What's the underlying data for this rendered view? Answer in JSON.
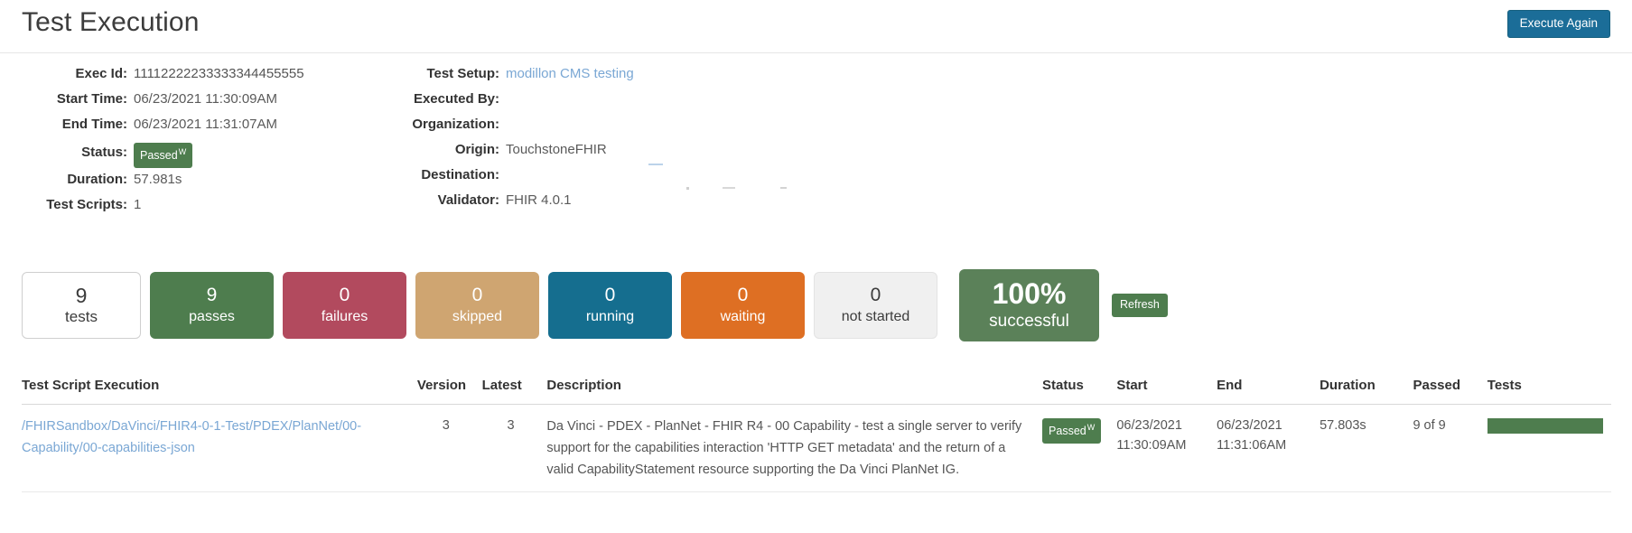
{
  "header": {
    "title": "Test Execution",
    "execute_again_label": "Execute Again"
  },
  "info": {
    "left": [
      {
        "label": "Exec Id:",
        "value": "11112222233333344455555",
        "type": "text"
      },
      {
        "label": "Start Time:",
        "value": "06/23/2021 11:30:09AM",
        "type": "text"
      },
      {
        "label": "End Time:",
        "value": "06/23/2021 11:31:07AM",
        "type": "text"
      },
      {
        "label": "Status:",
        "value": "Passed",
        "type": "badge",
        "badge_sup": "W"
      },
      {
        "label": "Duration:",
        "value": "57.981s",
        "type": "text"
      },
      {
        "label": "Test Scripts:",
        "value": "1",
        "type": "text"
      }
    ],
    "right": [
      {
        "label": "Test Setup:",
        "value": "modillon CMS testing",
        "type": "link"
      },
      {
        "label": "Executed By:",
        "value": "",
        "type": "text"
      },
      {
        "label": "Organization:",
        "value": "",
        "type": "text"
      },
      {
        "label": "Origin:",
        "value": "TouchstoneFHIR",
        "type": "text"
      },
      {
        "label": "Destination:",
        "value": "",
        "type": "text"
      },
      {
        "label": "Validator:",
        "value": "FHIR 4.0.1",
        "type": "text"
      }
    ]
  },
  "tiles": [
    {
      "key": "tests",
      "number": "9",
      "label": "tests",
      "color": "#ffffff"
    },
    {
      "key": "passes",
      "number": "9",
      "label": "passes",
      "color": "#4e7d4e"
    },
    {
      "key": "failures",
      "number": "0",
      "label": "failures",
      "color": "#b24a5e"
    },
    {
      "key": "skipped",
      "number": "0",
      "label": "skipped",
      "color": "#cfa571"
    },
    {
      "key": "running",
      "number": "0",
      "label": "running",
      "color": "#156e8f"
    },
    {
      "key": "waiting",
      "number": "0",
      "label": "waiting",
      "color": "#de6f23"
    },
    {
      "key": "notstarted",
      "number": "0",
      "label": "not started",
      "color": "#f0f0f0"
    },
    {
      "key": "success",
      "number": "100%",
      "label": "successful",
      "color": "#5b8159"
    }
  ],
  "refresh_label": "Refresh",
  "table": {
    "headers": [
      "Test Script Execution",
      "Version",
      "Latest",
      "Description",
      "Status",
      "Start",
      "End",
      "Duration",
      "Passed",
      "Tests"
    ],
    "rows": [
      {
        "name": "/FHIRSandbox/DaVinci/FHIR4-0-1-Test/PDEX/PlanNet/00-Capability/00-capabilities-json",
        "version": "3",
        "latest": "3",
        "description": "Da Vinci - PDEX - PlanNet - FHIR R4 - 00 Capability - test a single server to verify support for the capabilities interaction 'HTTP GET metadata' and the return of a valid CapabilityStatement resource supporting the Da Vinci PlanNet IG.",
        "status": "Passed",
        "status_sup": "W",
        "start_date": "06/23/2021",
        "start_time": "11:30:09AM",
        "end_date": "06/23/2021",
        "end_time": "11:31:06AM",
        "duration": "57.803s",
        "passed": "9 of 9",
        "tests_bar_percent": 100
      }
    ]
  }
}
